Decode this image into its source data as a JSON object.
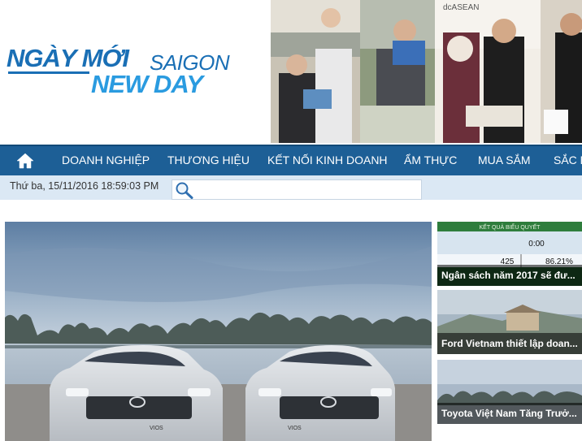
{
  "logo": {
    "top": "NGÀY MỚI",
    "saigon": "SAIGON",
    "newday": "NEW DAY"
  },
  "nav": {
    "home_icon": "home-icon",
    "items": [
      "DOANH NGHIỆP",
      "THƯƠNG HIỆU",
      "KẾT NỐI KINH DOANH",
      "ẨM THỰC",
      "MUA SẮM",
      "SẮC MÀU"
    ]
  },
  "datebar": {
    "date": "Thứ ba, 15/11/2016 18:59:03 PM",
    "search_icon": "search-icon",
    "search_value": ""
  },
  "side_news": [
    {
      "caption": "Ngân sách năm 2017 sẽ đư...",
      "screen": {
        "title": "KẾT QUẢ BIỂU QUYẾT",
        "r1_value": "0:00",
        "r2_count": "425",
        "r2_percent": "86.21%"
      }
    },
    {
      "caption": "Ford Vietnam thiết lập doan..."
    },
    {
      "caption": "Toyota Việt Nam Tăng Trưở..."
    }
  ],
  "main_story": {
    "car_badge_left": "VIOS",
    "car_badge_right": "VIOS"
  },
  "colors": {
    "brand_blue": "#1a6fb5",
    "brand_light_blue": "#2a9be0",
    "nav_bg": "#1d5f96",
    "datebar_bg": "#dbe8f4"
  }
}
